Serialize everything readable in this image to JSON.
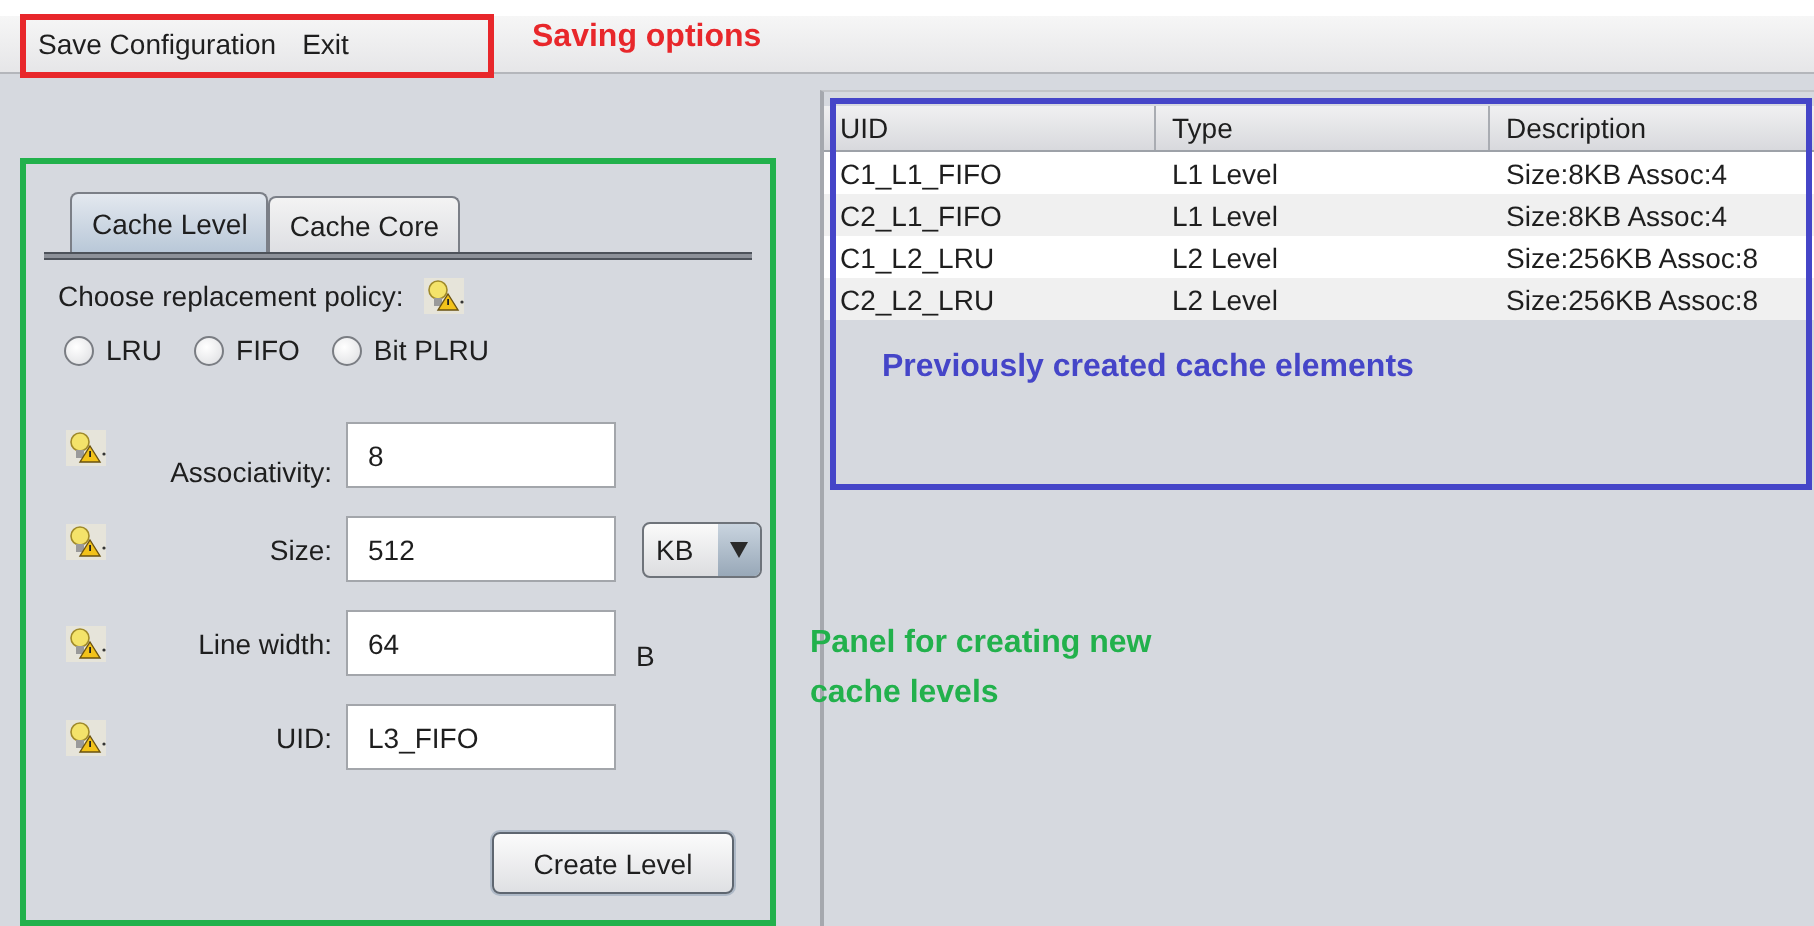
{
  "menu": [
    {
      "label": "Save Configuration"
    },
    {
      "label": "Exit"
    }
  ],
  "tabs": [
    {
      "label": "Cache Level",
      "selected": true
    },
    {
      "label": "Cache Core",
      "selected": false
    }
  ],
  "policy": {
    "label": "Choose replacement policy:",
    "options": [
      {
        "label": "LRU",
        "selected": false
      },
      {
        "label": "FIFO",
        "selected": false
      },
      {
        "label": "Bit PLRU",
        "selected": false
      }
    ]
  },
  "fields": [
    {
      "label": "Associativity:",
      "value": "8",
      "kind": "plain"
    },
    {
      "label": "Size:",
      "value": "512",
      "kind": "dropdown",
      "unit": "KB"
    },
    {
      "label": "Line width:",
      "value": "64",
      "kind": "unit",
      "unit": "B"
    },
    {
      "label": "UID:",
      "value": "L3_FIFO",
      "kind": "plain"
    }
  ],
  "create_button": "Create Level",
  "table": {
    "columns": [
      "UID",
      "Type",
      "Description"
    ],
    "rows": [
      [
        "C1_L1_FIFO",
        "L1 Level",
        "Size:8KB Assoc:4"
      ],
      [
        "C2_L1_FIFO",
        "L1 Level",
        "Size:8KB Assoc:4"
      ],
      [
        "C1_L2_LRU",
        "L2 Level",
        "Size:256KB Assoc:8"
      ],
      [
        "C2_L2_LRU",
        "L2 Level",
        "Size:256KB Assoc:8"
      ]
    ]
  },
  "annotations": [
    {
      "text": "Saving options",
      "color": "#e8272b"
    },
    {
      "text": "Previously created cache elements",
      "color": "#4545c8"
    },
    {
      "text": "Panel for creating new cache levels",
      "color": "#22b14c"
    }
  ]
}
